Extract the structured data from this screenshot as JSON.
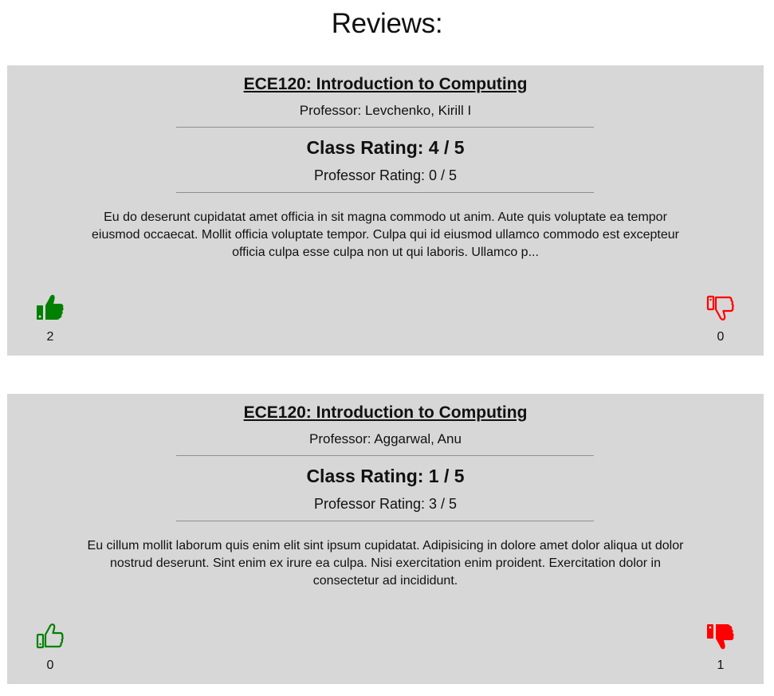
{
  "page": {
    "title": "Reviews:"
  },
  "colors": {
    "upvote": "#008000",
    "downvote": "#ff0000",
    "card_bg": "#d7d7d7"
  },
  "reviews": [
    {
      "course": "ECE120: Introduction to Computing",
      "professor": "Professor: Levchenko, Kirill I",
      "class_rating": "Class Rating: 4 / 5",
      "professor_rating": "Professor Rating: 0 / 5",
      "text": "Eu do deserunt cupidatat amet officia in sit magna commodo ut anim. Aute quis voluptate ea tempor eiusmod occaecat. Mollit officia voluptate tempor. Culpa qui id eiusmod ullamco commodo est excepteur officia culpa esse culpa non ut qui laboris. Ullamco p...",
      "upvotes": "2",
      "downvotes": "0",
      "upvote_icon": "thumbs-up-filled-icon",
      "downvote_icon": "thumbs-down-outline-icon"
    },
    {
      "course": "ECE120: Introduction to Computing",
      "professor": "Professor: Aggarwal, Anu",
      "class_rating": "Class Rating: 1 / 5",
      "professor_rating": "Professor Rating: 3 / 5",
      "text": "Eu cillum mollit laborum quis enim elit sint ipsum cupidatat. Adipisicing in dolore amet dolor aliqua ut dolor nostrud deserunt. Sint enim ex irure ea culpa. Nisi exercitation enim proident. Exercitation dolor in consectetur ad incididunt.",
      "upvotes": "0",
      "downvotes": "1",
      "upvote_icon": "thumbs-up-outline-icon",
      "downvote_icon": "thumbs-down-filled-icon"
    }
  ]
}
